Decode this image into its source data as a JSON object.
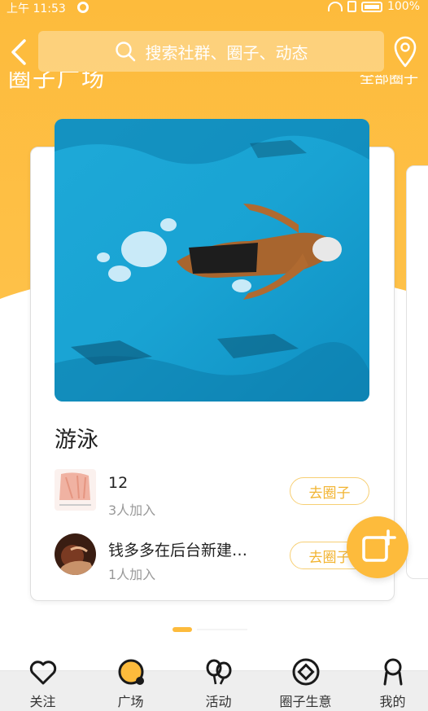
{
  "status_bar": {
    "time": "上午 11:53",
    "battery": "100%"
  },
  "nav": {
    "search_placeholder": "搜索社群、圈子、动态"
  },
  "section": {
    "title": "圈子广场",
    "more_label": "全部圈子"
  },
  "card": {
    "title": "游泳",
    "members": [
      {
        "name": "12",
        "joined": "3人加入",
        "button": "去圈子"
      },
      {
        "name": "钱多多在后台新建…",
        "joined": "1人加入",
        "button": "去圈子"
      }
    ]
  },
  "tabs": [
    {
      "label": "关注",
      "icon": "heart-icon"
    },
    {
      "label": "广场",
      "icon": "plaza-icon"
    },
    {
      "label": "活动",
      "icon": "balloon-icon"
    },
    {
      "label": "圈子生意",
      "icon": "business-icon"
    },
    {
      "label": "我的",
      "icon": "profile-icon"
    }
  ],
  "colors": {
    "accent": "#fdbb3c",
    "button_text": "#f2b431",
    "pool": "#1aa5d6"
  },
  "pager": {
    "active_index": 0
  }
}
